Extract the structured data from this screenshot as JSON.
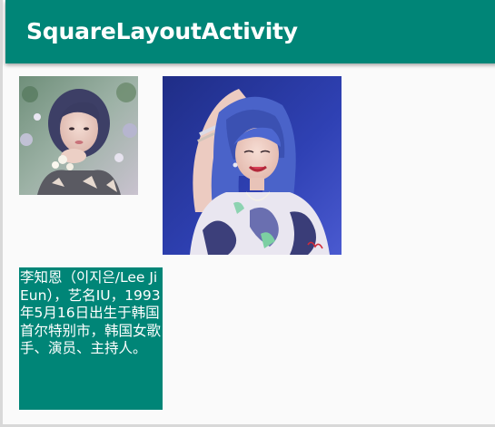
{
  "app_bar": {
    "title": "SquareLayoutActivity",
    "background_color": "#008577",
    "title_color": "#ffffff"
  },
  "content": {
    "images": [
      {
        "name": "portrait-photo-small",
        "description_icon": "photo"
      },
      {
        "name": "portrait-photo-large",
        "description_icon": "photo"
      }
    ],
    "text_block": {
      "text": "李知恩（이지은/Lee Ji Eun），艺名IU，1993年5月16日出生于韩国首尔特别市，韩国女歌手、演员、主持人。",
      "background_color": "#008577",
      "text_color": "#ffffff"
    }
  }
}
